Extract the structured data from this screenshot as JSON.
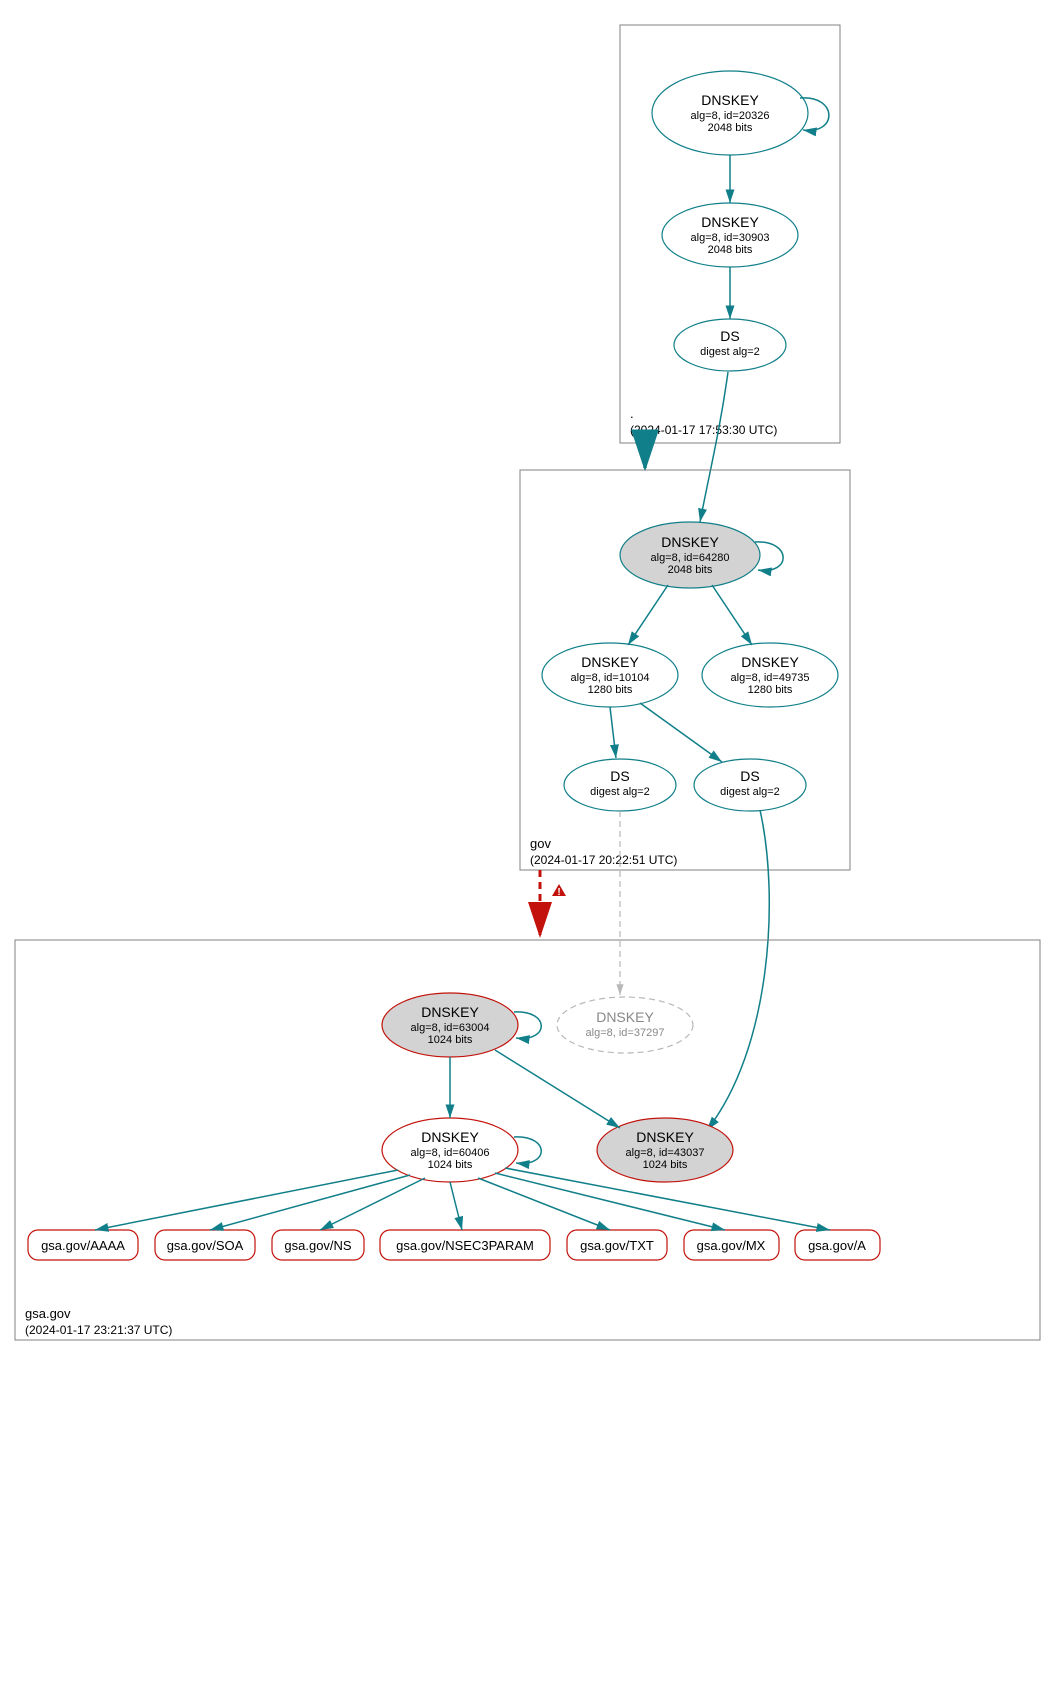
{
  "zones": {
    "root": {
      "name": ".",
      "timestamp": "(2024-01-17 17:53:30 UTC)"
    },
    "gov": {
      "name": "gov",
      "timestamp": "(2024-01-17 20:22:51 UTC)"
    },
    "gsa": {
      "name": "gsa.gov",
      "timestamp": "(2024-01-17 23:21:37 UTC)"
    }
  },
  "nodes": {
    "root_ksk": {
      "title": "DNSKEY",
      "line2": "alg=8, id=20326",
      "line3": "2048 bits"
    },
    "root_zsk": {
      "title": "DNSKEY",
      "line2": "alg=8, id=30903",
      "line3": "2048 bits"
    },
    "root_ds": {
      "title": "DS",
      "line2": "digest alg=2"
    },
    "gov_ksk": {
      "title": "DNSKEY",
      "line2": "alg=8, id=64280",
      "line3": "2048 bits"
    },
    "gov_zsk1": {
      "title": "DNSKEY",
      "line2": "alg=8, id=10104",
      "line3": "1280 bits"
    },
    "gov_zsk2": {
      "title": "DNSKEY",
      "line2": "alg=8, id=49735",
      "line3": "1280 bits"
    },
    "gov_ds1": {
      "title": "DS",
      "line2": "digest alg=2"
    },
    "gov_ds2": {
      "title": "DS",
      "line2": "digest alg=2"
    },
    "gsa_ksk": {
      "title": "DNSKEY",
      "line2": "alg=8, id=63004",
      "line3": "1024 bits"
    },
    "gsa_grey": {
      "title": "DNSKEY",
      "line2": "alg=8, id=37297"
    },
    "gsa_zsk": {
      "title": "DNSKEY",
      "line2": "alg=8, id=60406",
      "line3": "1024 bits"
    },
    "gsa_alt": {
      "title": "DNSKEY",
      "line2": "alg=8, id=43037",
      "line3": "1024 bits"
    }
  },
  "rrsets": {
    "aaaa": "gsa.gov/AAAA",
    "soa": "gsa.gov/SOA",
    "ns": "gsa.gov/NS",
    "nsec": "gsa.gov/NSEC3PARAM",
    "txt": "gsa.gov/TXT",
    "mx": "gsa.gov/MX",
    "a": "gsa.gov/A"
  }
}
